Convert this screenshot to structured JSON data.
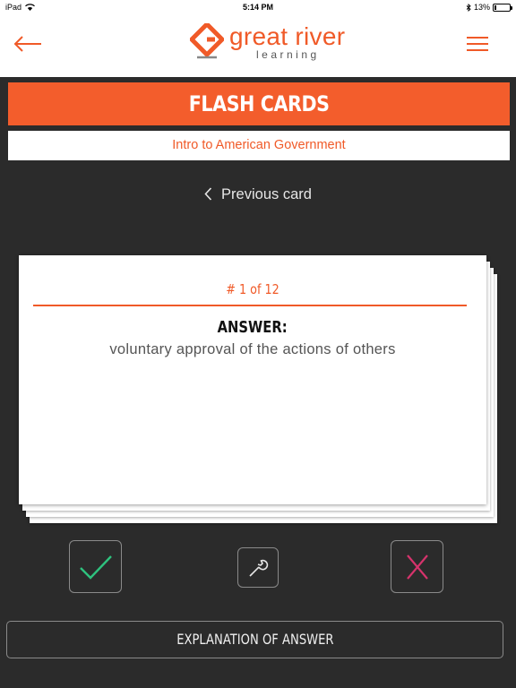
{
  "status_bar": {
    "device": "iPad",
    "time": "5:14 PM",
    "battery_percent": "13%",
    "battery_level": 0.13
  },
  "header": {
    "logo_main": "great river",
    "logo_sub": "learning",
    "back_icon": "arrow-left-icon",
    "menu_icon": "hamburger-menu-icon"
  },
  "title": "FLASH CARDS",
  "subject": "Intro to American Government",
  "navigation": {
    "previous_label": "Previous card"
  },
  "card": {
    "counter": "# 1 of 12",
    "label": "ANSWER:",
    "text": "voluntary approval of the actions of others"
  },
  "actions": {
    "correct_icon": "checkmark-icon",
    "tools_icon": "wrench-icon",
    "wrong_icon": "x-icon",
    "explanation_label": "EXPLANATION OF ANSWER"
  },
  "colors": {
    "accent": "#f35d2c",
    "correct": "#2ec27e",
    "wrong": "#d6336c",
    "background": "#2b2b2b"
  }
}
